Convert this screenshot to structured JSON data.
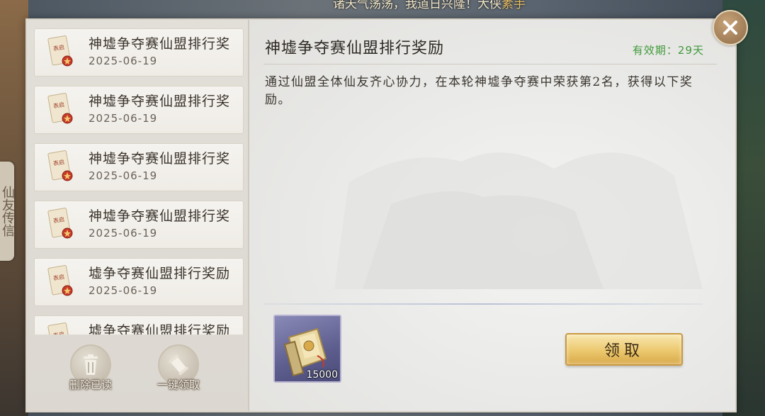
{
  "marquee": {
    "text": "诸天气荡荡，我道日兴隆！大侠",
    "highlight": "素手"
  },
  "side_tab": {
    "label": "仙友传信"
  },
  "mail_list": [
    {
      "title": "神墟争夺赛仙盟排行奖",
      "date": "2025-06-19"
    },
    {
      "title": "神墟争夺赛仙盟排行奖",
      "date": "2025-06-19"
    },
    {
      "title": "神墟争夺赛仙盟排行奖",
      "date": "2025-06-19"
    },
    {
      "title": "神墟争夺赛仙盟排行奖",
      "date": "2025-06-19"
    },
    {
      "title": "墟争夺赛仙盟排行奖励",
      "date": "2025-06-19"
    },
    {
      "title": "墟争夺赛仙盟排行奖励",
      "date": ""
    }
  ],
  "mail_icon_text": "表启",
  "actions": {
    "delete_read": "删除已读",
    "claim_all": "一键领取"
  },
  "detail": {
    "title": "神墟争夺赛仙盟排行奖励",
    "validity": "有效期：29天",
    "body": "通过仙盟全体仙友齐心协力，在本轮神墟争夺赛中荣获第2名，获得以下奖励。"
  },
  "reward": {
    "icon": "scroll-item-icon",
    "quantity": "15000"
  },
  "claim_label": "领取",
  "colors": {
    "validity": "#3f9a3a",
    "claim_button": "#ecc86e",
    "reward_bg": "#5d5e8e"
  }
}
